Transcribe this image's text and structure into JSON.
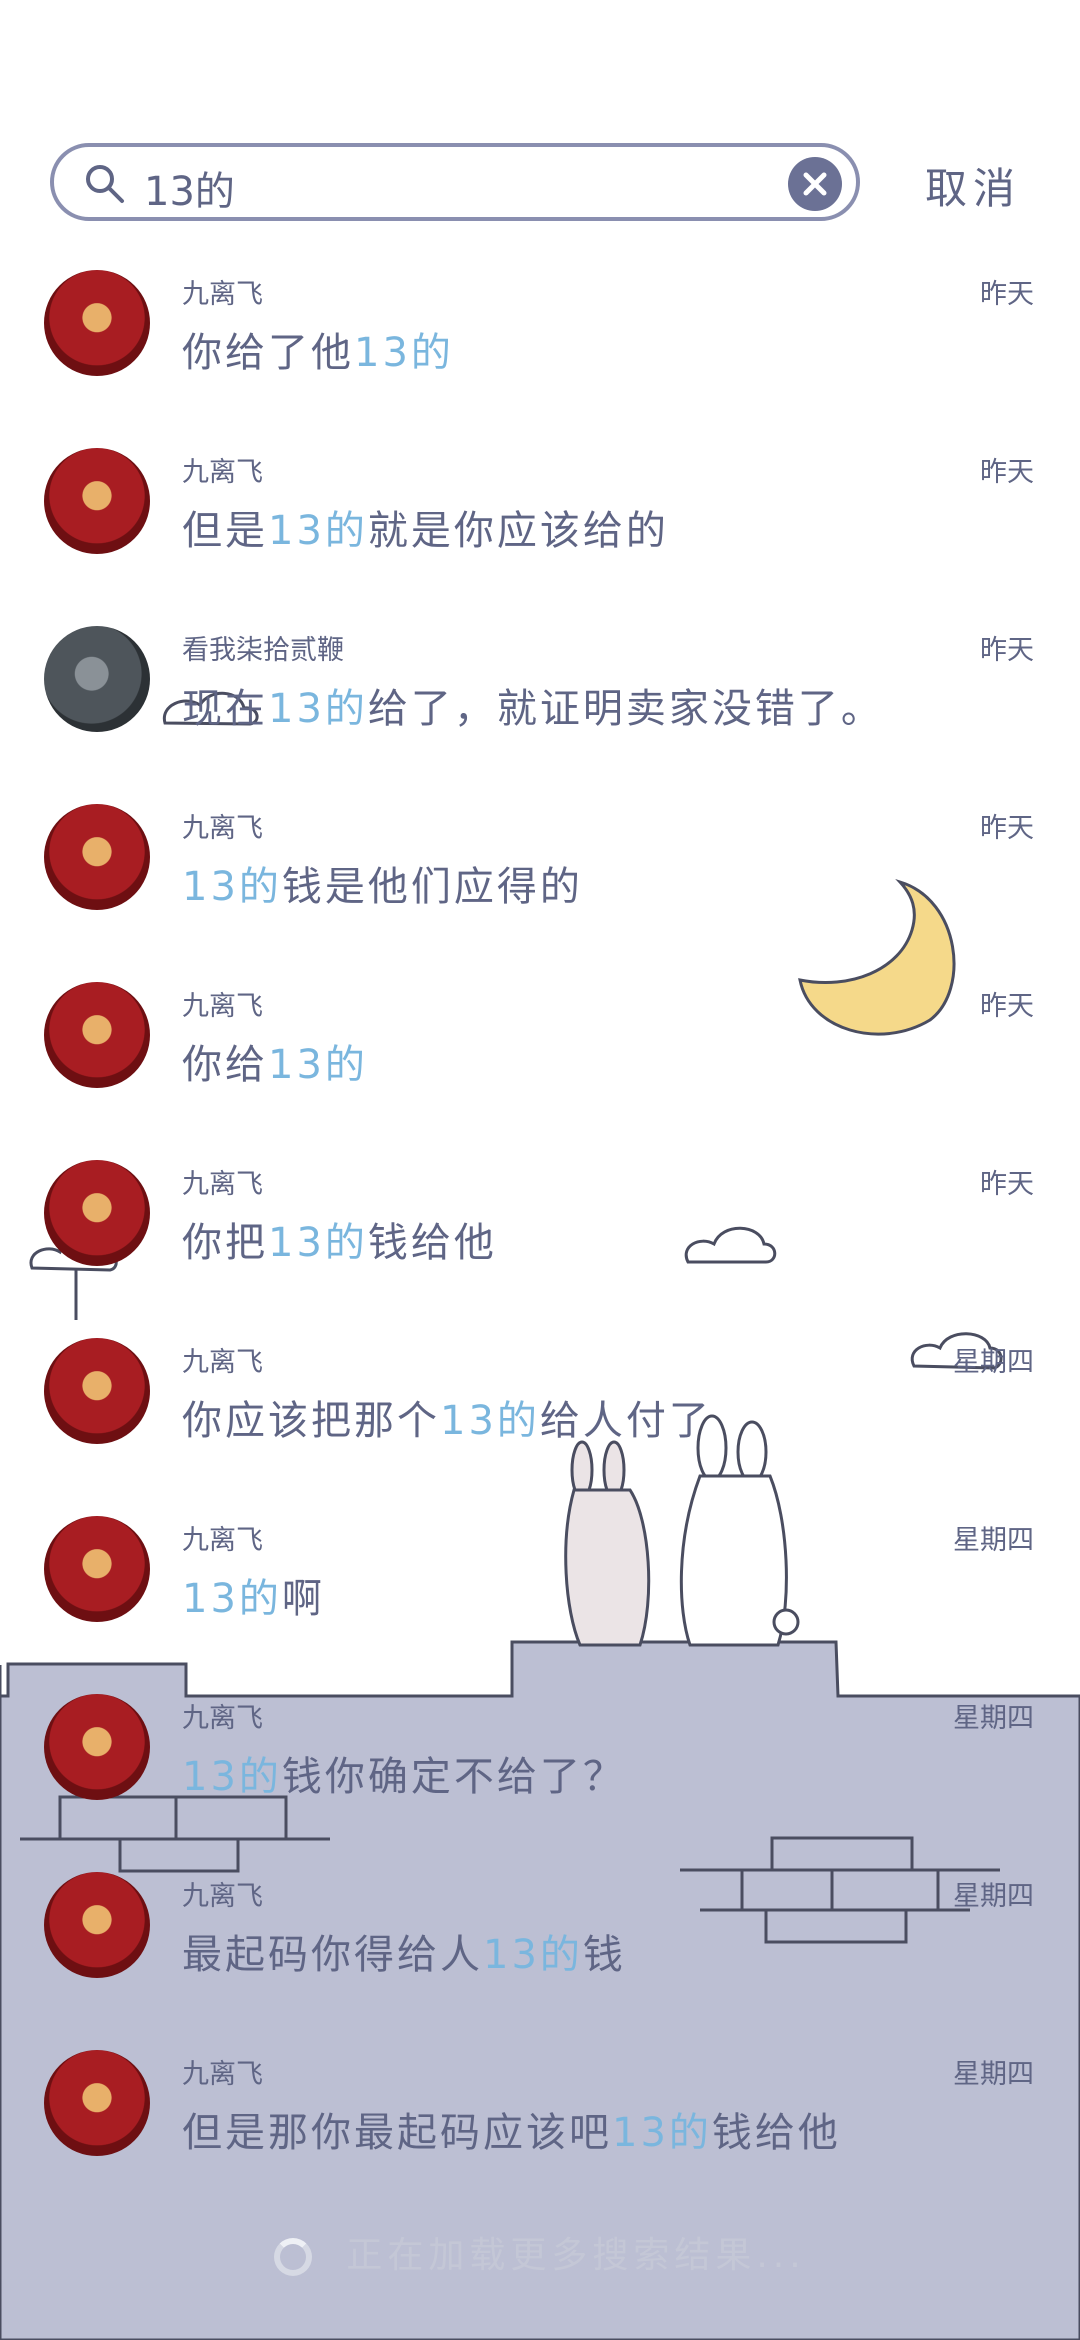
{
  "search": {
    "query": "13的"
  },
  "cancel_label": "取消",
  "results": [
    {
      "sender": "九离飞",
      "time": "昨天",
      "pre": "你给了他",
      "hl": "13的",
      "post": ""
    },
    {
      "sender": "九离飞",
      "time": "昨天",
      "pre": "但是",
      "hl": "13的",
      "post": "就是你应该给的"
    },
    {
      "sender": "看我柒拾贰鞭",
      "time": "昨天",
      "pre": "现在",
      "hl": "13的",
      "post": "给了，就证明卖家没错了。"
    },
    {
      "sender": "九离飞",
      "time": "昨天",
      "pre": "",
      "hl": "13的",
      "post": "钱是他们应得的"
    },
    {
      "sender": "九离飞",
      "time": "昨天",
      "pre": "你给",
      "hl": "13的",
      "post": ""
    },
    {
      "sender": "九离飞",
      "time": "昨天",
      "pre": "你把",
      "hl": "13的",
      "post": "钱给他"
    },
    {
      "sender": "九离飞",
      "time": "星期四",
      "pre": "你应该把那个",
      "hl": "13的",
      "post": "给人付了"
    },
    {
      "sender": "九离飞",
      "time": "星期四",
      "pre": "",
      "hl": "13的",
      "post": "啊"
    },
    {
      "sender": "九离飞",
      "time": "星期四",
      "pre": "",
      "hl": "13的",
      "post": "钱你确定不给了？"
    },
    {
      "sender": "九离飞",
      "time": "星期四",
      "pre": "最起码你得给人",
      "hl": "13的",
      "post": "钱"
    },
    {
      "sender": "九离飞",
      "time": "星期四",
      "pre": "但是那你最起码应该吧",
      "hl": "13的",
      "post": "钱给他"
    }
  ],
  "loading_text": "正在加载更多搜索结果...",
  "colors": {
    "highlight": "#7ab6de",
    "text": "#5f6585",
    "wall": "#bcbfd3",
    "moon": "#f5d98a"
  }
}
